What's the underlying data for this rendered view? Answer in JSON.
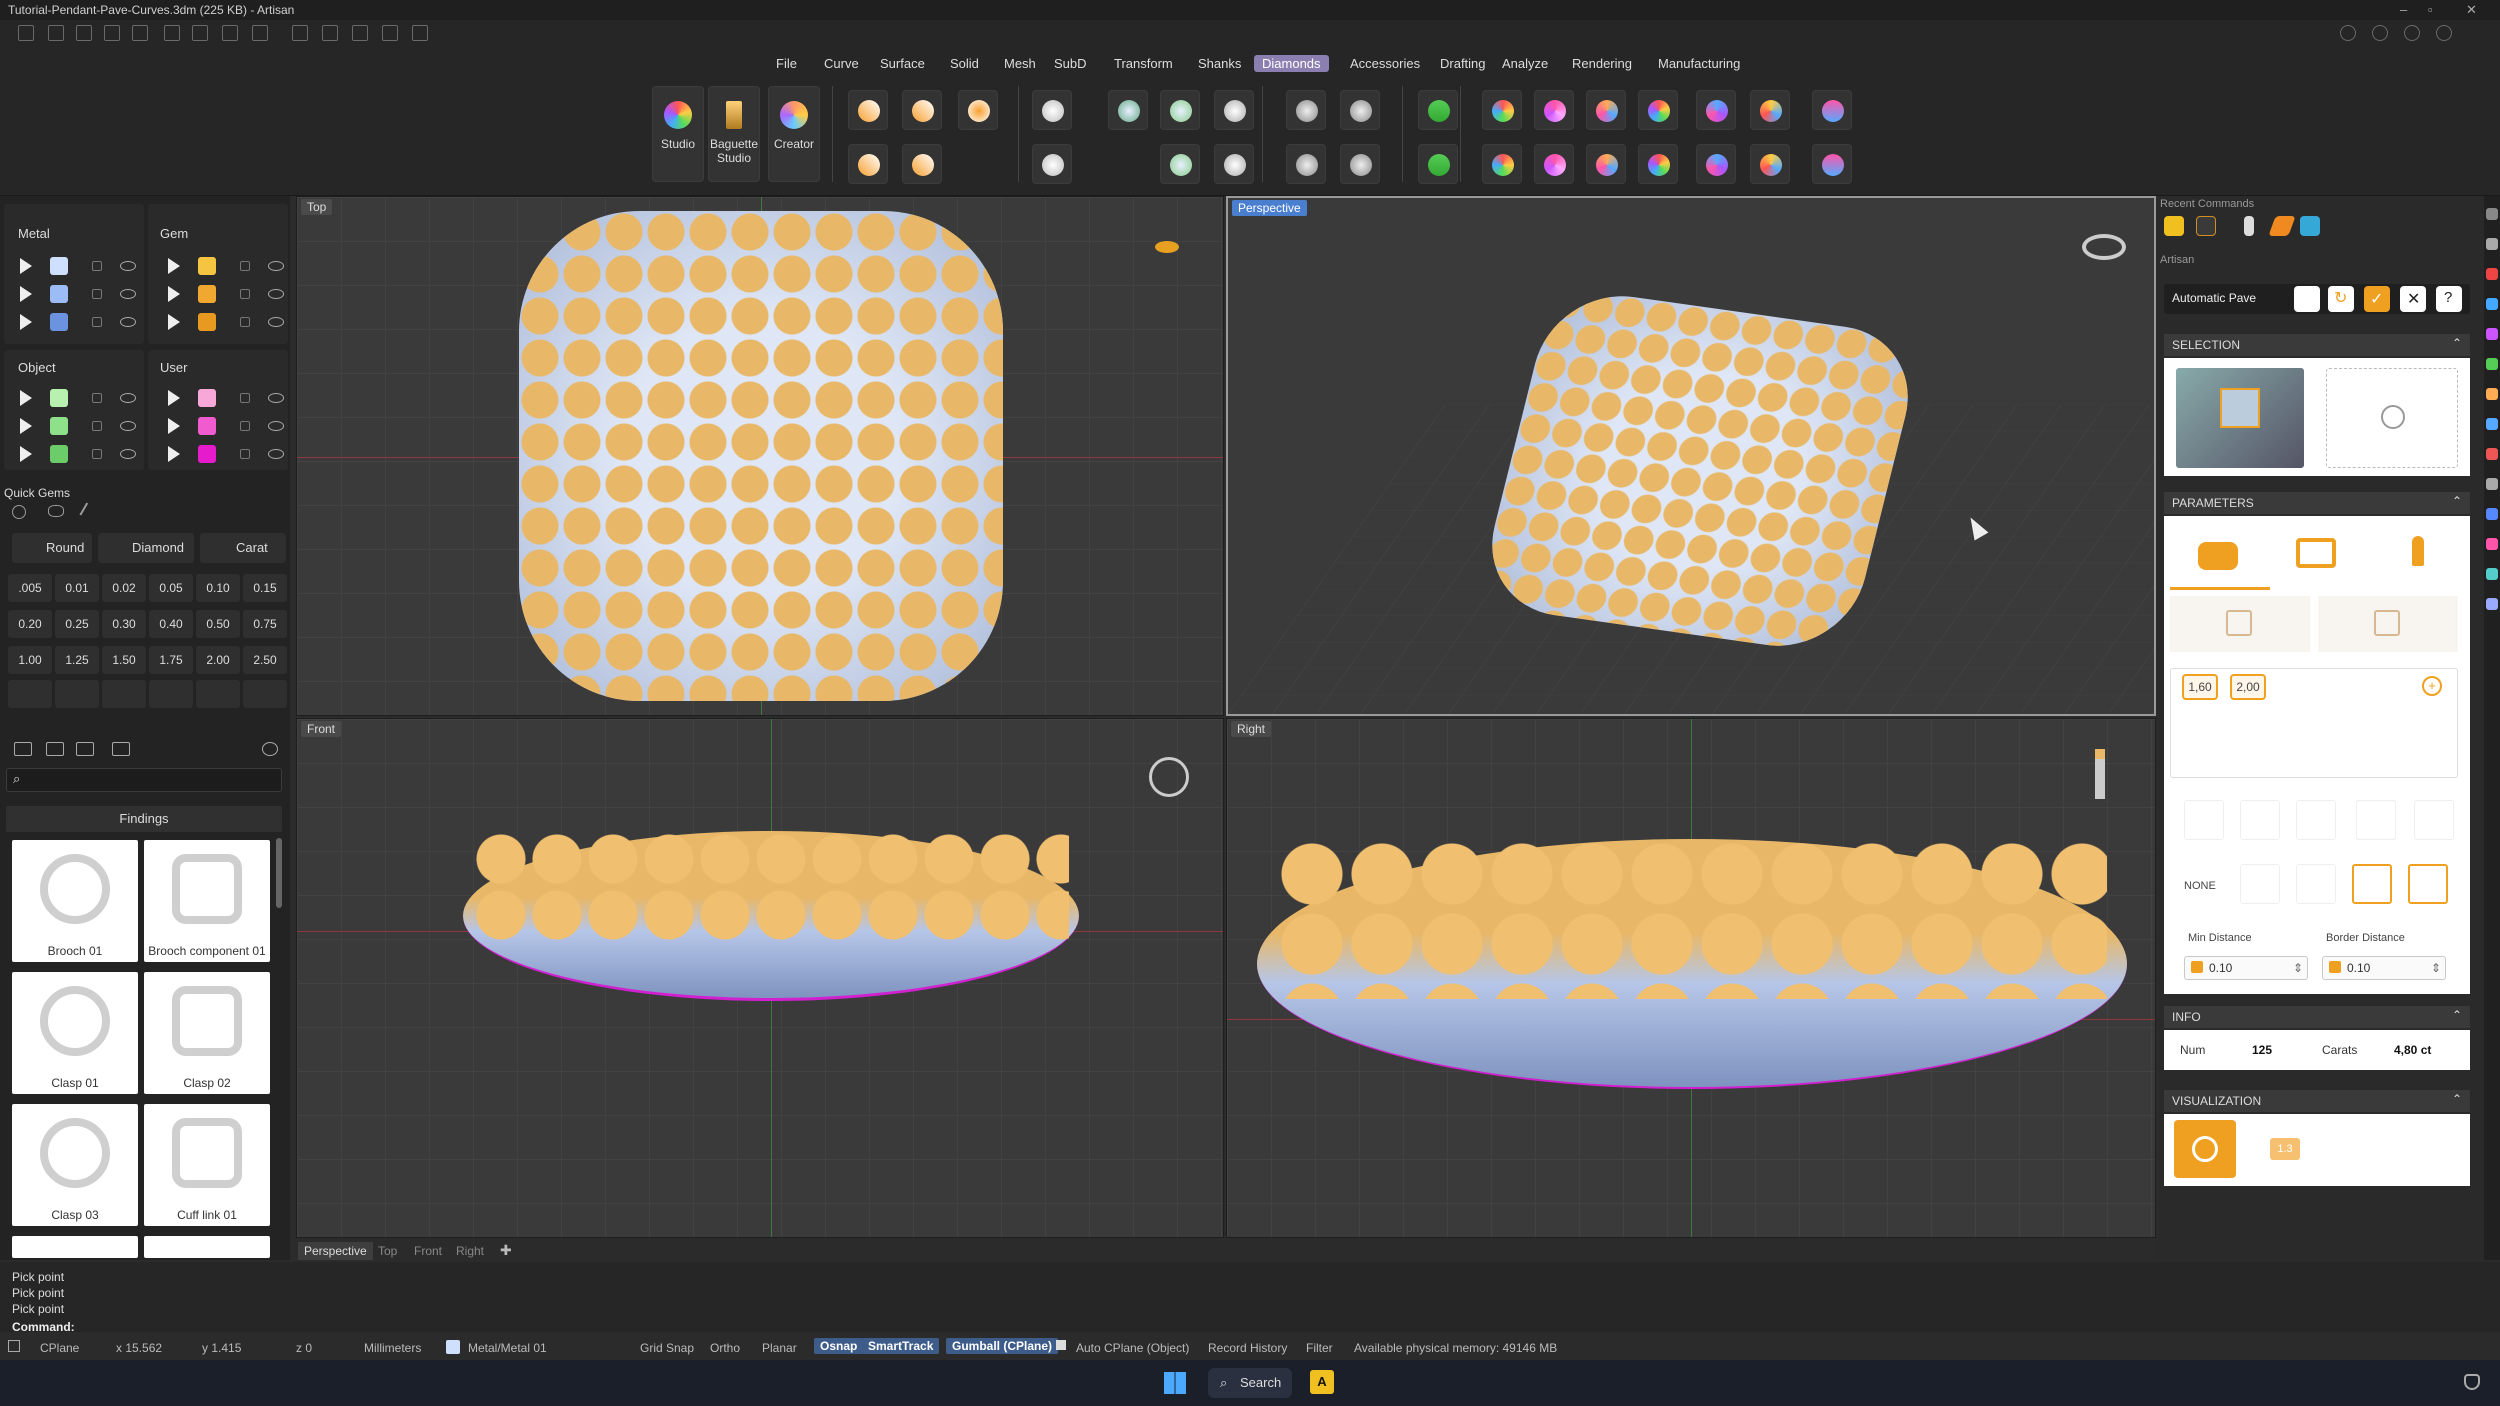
{
  "window": {
    "title": "Tutorial-Pendant-Pave-Curves.3dm (225 KB) - Artisan"
  },
  "menu": [
    "File",
    "Curve",
    "Surface",
    "Solid",
    "Mesh",
    "SubD",
    "Transform",
    "Shanks",
    "Diamonds",
    "Accessories",
    "Drafting",
    "Analyze",
    "Rendering",
    "Manufacturing"
  ],
  "menu_active": "Diamonds",
  "ribbon": {
    "studio": "Studio",
    "baguette": "Baguette Studio",
    "creator": "Creator"
  },
  "layers": {
    "metal": "Metal",
    "gem": "Gem",
    "object": "Object",
    "user": "User",
    "metal_colors": [
      "#cfe0ff",
      "#9bbcf5",
      "#6b93e0"
    ],
    "gem_colors": [
      "#f5c542",
      "#f0a830",
      "#e89a20"
    ],
    "object_colors": [
      "#b8f0b0",
      "#8ee08a",
      "#6dcc6a"
    ],
    "user_colors": [
      "#f7a8d8",
      "#f05ccf",
      "#e61ccc"
    ]
  },
  "quick_gems": {
    "title": "Quick Gems",
    "shape": "Round",
    "cut": "Diamond",
    "unit": "Carat",
    "sizes": [
      ".005",
      "0.01",
      "0.02",
      "0.05",
      "0.10",
      "0.15",
      "0.20",
      "0.25",
      "0.30",
      "0.40",
      "0.50",
      "0.75",
      "1.00",
      "1.25",
      "1.50",
      "1.75",
      "2.00",
      "2.50"
    ]
  },
  "library": {
    "search_placeholder": "",
    "category": "Findings",
    "items": [
      "Brooch 01",
      "Brooch component 01",
      "Clasp 01",
      "Clasp 02",
      "Clasp 03",
      "Cuff link 01"
    ]
  },
  "viewports": {
    "top": "Top",
    "perspective": "Perspective",
    "front": "Front",
    "right": "Right"
  },
  "viewport_tabs": [
    "Perspective",
    "Top",
    "Front",
    "Right"
  ],
  "recent_commands": "Recent Commands",
  "artisan": "Artisan",
  "command_name": "Automatic Pave",
  "sections": {
    "selection": "SELECTION",
    "parameters": "PARAMETERS",
    "info": "INFO",
    "visualization": "VISUALIZATION"
  },
  "parameters": {
    "size_a": "1,60",
    "size_b": "2,00",
    "none_label": "NONE",
    "min_distance_label": "Min Distance",
    "min_distance": "0.10",
    "border_distance_label": "Border Distance",
    "border_distance": "0.10"
  },
  "info": {
    "num_label": "Num",
    "num": "125",
    "carats_label": "Carats",
    "carats": "4,80 ct"
  },
  "visualization": {
    "badge": "1.3"
  },
  "command_history": [
    "Pick point",
    "Pick point",
    "Pick point"
  ],
  "command_prompt": "Command:",
  "status": {
    "cplane": "CPlane",
    "x": "x 15.562",
    "y": "y 1.415",
    "z": "z 0",
    "units": "Millimeters",
    "layer": "Metal/Metal 01",
    "toggles": [
      "Grid Snap",
      "Ortho",
      "Planar",
      "Osnap",
      "SmartTrack",
      "Gumball (CPlane)",
      "Auto CPlane (Object)",
      "Record History",
      "Filter"
    ],
    "toggles_on": [
      "Osnap",
      "SmartTrack",
      "Gumball (CPlane)"
    ],
    "memory": "Available physical memory: 49146 MB"
  },
  "taskbar": {
    "search": "Search"
  }
}
